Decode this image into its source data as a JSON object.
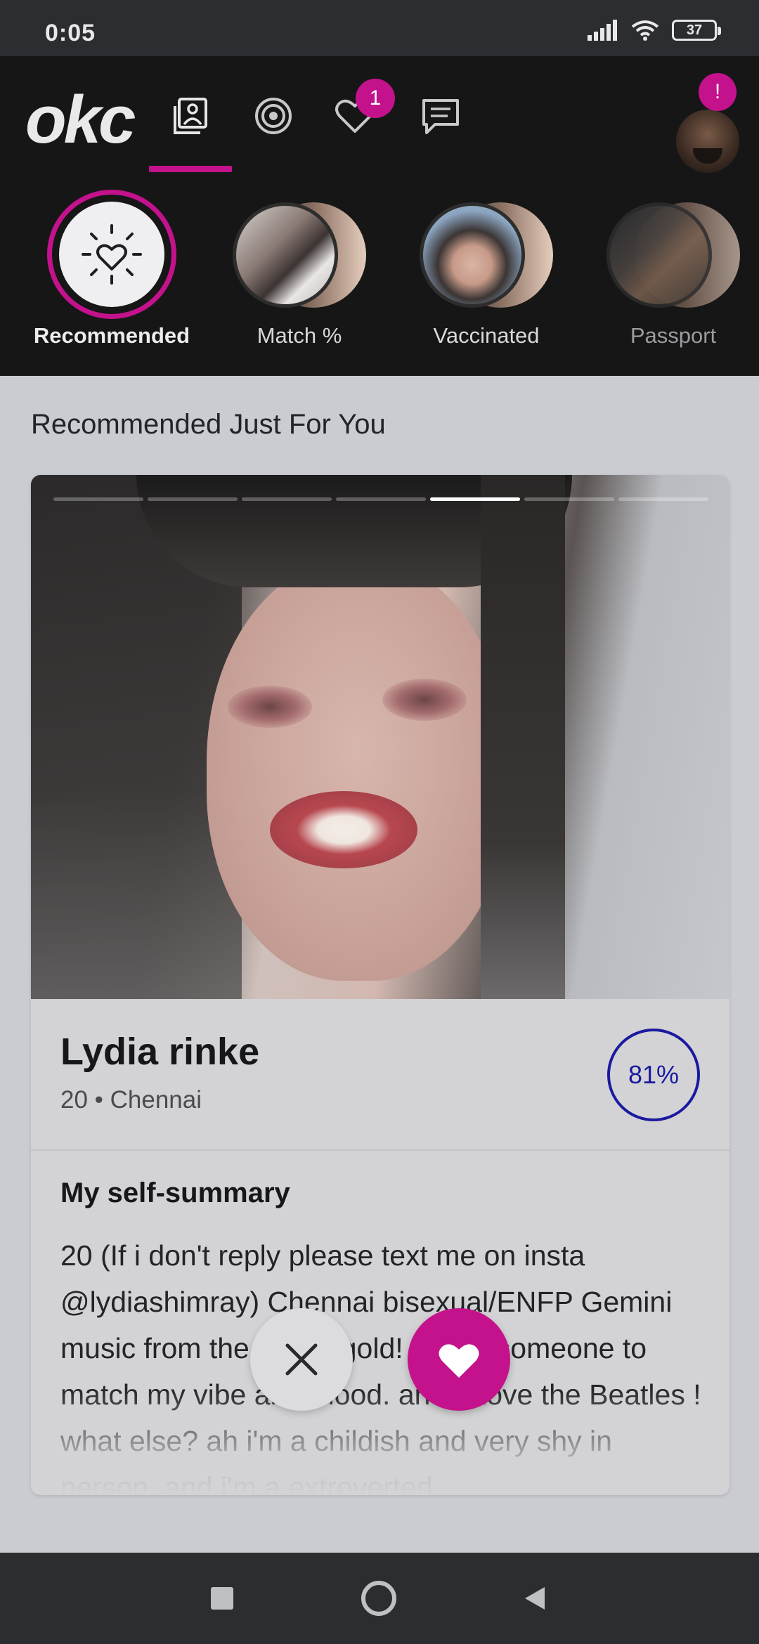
{
  "status_bar": {
    "time": "0:05",
    "battery": "37"
  },
  "header": {
    "logo": "okc",
    "likes_badge": "1",
    "profile_badge": "!",
    "tabs": [
      {
        "icon": "discover-cards-icon",
        "active": true
      },
      {
        "icon": "doubletake-radar-icon",
        "active": false
      },
      {
        "icon": "likes-heart-icon",
        "active": false
      },
      {
        "icon": "messages-chat-icon",
        "active": false
      }
    ]
  },
  "filters": [
    {
      "label": "Recommended",
      "active": true
    },
    {
      "label": "Match %",
      "active": false
    },
    {
      "label": "Vaccinated",
      "active": false
    },
    {
      "label": "Passport",
      "active": false
    }
  ],
  "section_title": "Recommended Just For You",
  "profile": {
    "name": "Lydia rinke",
    "meta": "20 • Chennai",
    "match": "81%",
    "photo_index": 5,
    "photo_count": 7,
    "summary_title": "My self-summary",
    "summary": "20 (If i don't reply please text me on insta @lydiashimray) Chennai bisexual/ENFP Gemini music from the 60s is gold! I want someone to match my vibe and mood. and I Love the Beatles ! what else? ah i'm a childish and very shy in person, and i'm a extroverted"
  },
  "colors": {
    "accent": "#c4128c",
    "match": "#1a1aa0"
  }
}
